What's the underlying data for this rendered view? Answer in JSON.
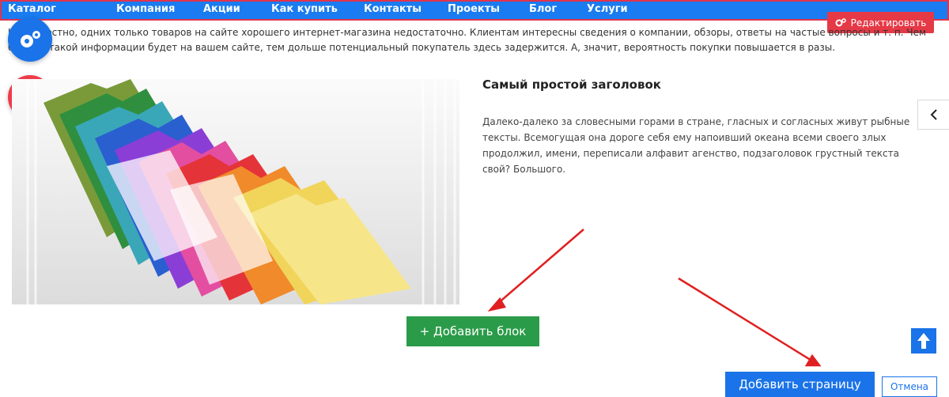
{
  "nav": {
    "items": [
      "Каталог",
      "Компания",
      "Акции",
      "Как купить",
      "Контакты",
      "Проекты",
      "Блог",
      "Услуги"
    ]
  },
  "edit_button": {
    "label": "Редактировать",
    "icon": "gears-icon"
  },
  "intro": {
    "text": "Как известно, одних только товаров на сайте хорошего интернет-магазина недостаточно. Клиентам интересны сведения о компании, обзоры, ответы на частые вопросы и т. п. Чем больше такой информации будет на вашем сайте, тем дольше потенциальный покупатель здесь задержится. А, значит, вероятность покупки повышается в разы."
  },
  "content": {
    "heading": "Самый простой заголовок",
    "paragraph": "Далеко-далеко за словесными горами в стране, гласных и согласных живут рыбные тексты. Всемогущая она дороге себя ему напоивший океана всеми своего злых продолжил, имени, переписали алфавит агенство, подзаголовок грустный текста свой? Большого."
  },
  "actions": {
    "add_block": "+ Добавить блок",
    "add_page": "Добавить страницу",
    "cancel": "Отмена"
  },
  "colors": {
    "nav_bg": "#1a7cf0",
    "nav_border": "#e0344c",
    "edit_bg": "#e53946",
    "add_block_bg": "#2a9b48",
    "primary": "#1a73e8",
    "arrow": "#e02020"
  }
}
